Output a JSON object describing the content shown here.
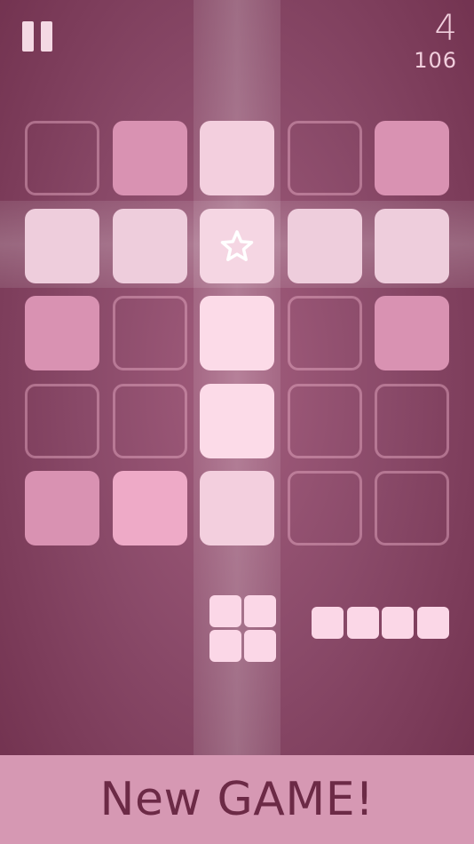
{
  "hud": {
    "level": "4",
    "score": "106"
  },
  "board": {
    "rows": 5,
    "cols": 5,
    "cells": [
      [
        "empty",
        "filled",
        "filled",
        "empty",
        "filled"
      ],
      [
        "filled",
        "filled",
        "star",
        "filled",
        "filled"
      ],
      [
        "filled",
        "empty",
        "filled",
        "empty",
        "filled"
      ],
      [
        "empty",
        "empty",
        "filled",
        "empty",
        "empty"
      ],
      [
        "filled",
        "filled",
        "filled",
        "empty",
        "empty"
      ]
    ]
  },
  "colors": {
    "filled_base": "#d38fad",
    "highlight": "#f6d9e5",
    "piece": "#fbd7e7",
    "button_bg": "#d698b3",
    "button_text": "#6c2a46"
  },
  "pieces": [
    {
      "name": "square-2x2",
      "shape": [
        [
          1,
          1
        ],
        [
          1,
          1
        ]
      ]
    },
    {
      "name": "line-1x4",
      "shape": [
        [
          1,
          1,
          1,
          1
        ]
      ]
    }
  ],
  "footer": {
    "new_game_label": "New GAME!"
  }
}
